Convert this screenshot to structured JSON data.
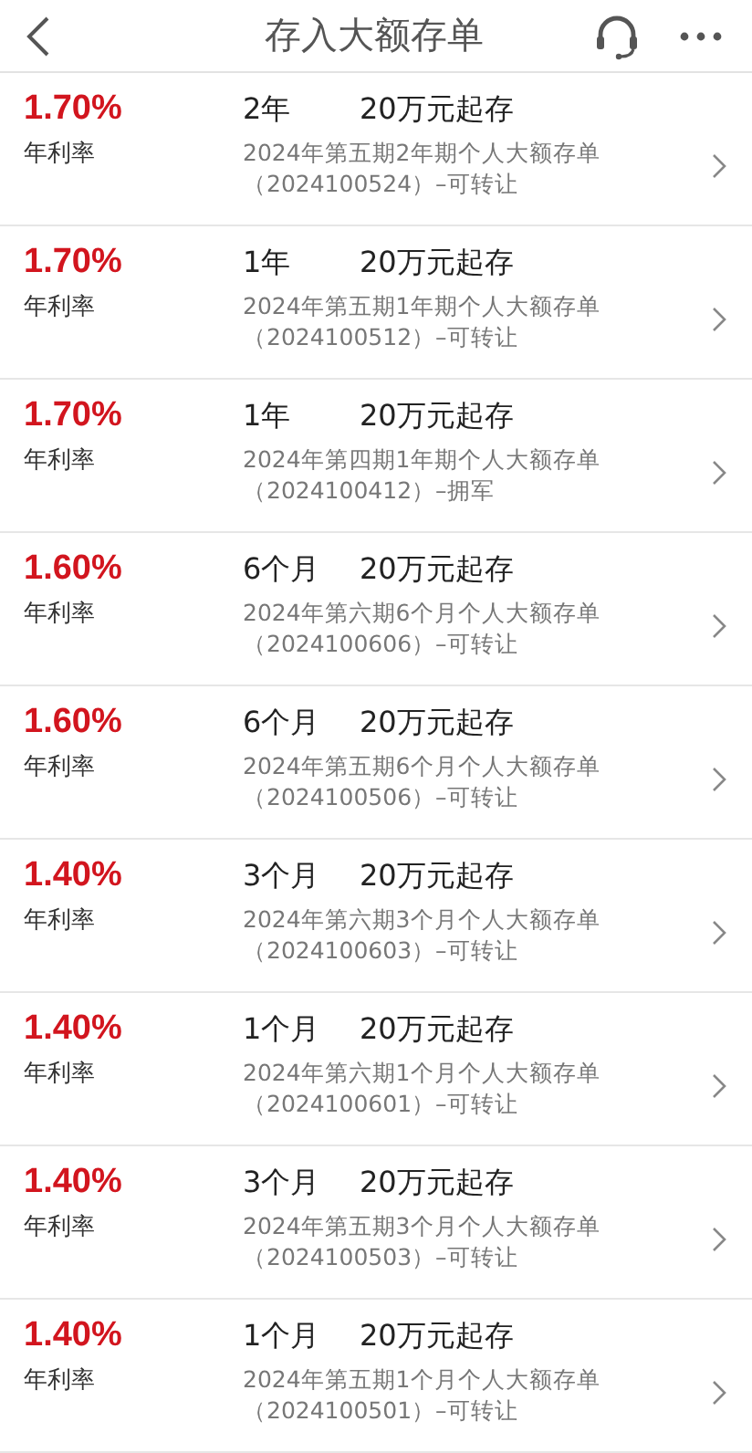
{
  "header": {
    "title": "存入大额存单"
  },
  "products": [
    {
      "rate": "1.70%",
      "rate_label": "年利率",
      "term": "2年",
      "minimum": "20万元起存",
      "name": "2024年第五期2年期个人大额存单",
      "code": "（2024100524）–可转让"
    },
    {
      "rate": "1.70%",
      "rate_label": "年利率",
      "term": "1年",
      "minimum": "20万元起存",
      "name": "2024年第五期1年期个人大额存单",
      "code": "（2024100512）–可转让"
    },
    {
      "rate": "1.70%",
      "rate_label": "年利率",
      "term": "1年",
      "minimum": "20万元起存",
      "name": "2024年第四期1年期个人大额存单",
      "code": "（2024100412）–拥军"
    },
    {
      "rate": "1.60%",
      "rate_label": "年利率",
      "term": "6个月",
      "minimum": "20万元起存",
      "name": "2024年第六期6个月个人大额存单",
      "code": "（2024100606）–可转让"
    },
    {
      "rate": "1.60%",
      "rate_label": "年利率",
      "term": "6个月",
      "minimum": "20万元起存",
      "name": "2024年第五期6个月个人大额存单",
      "code": "（2024100506）–可转让"
    },
    {
      "rate": "1.40%",
      "rate_label": "年利率",
      "term": "3个月",
      "minimum": "20万元起存",
      "name": "2024年第六期3个月个人大额存单",
      "code": "（2024100603）–可转让"
    },
    {
      "rate": "1.40%",
      "rate_label": "年利率",
      "term": "1个月",
      "minimum": "20万元起存",
      "name": "2024年第六期1个月个人大额存单",
      "code": "（2024100601）–可转让"
    },
    {
      "rate": "1.40%",
      "rate_label": "年利率",
      "term": "3个月",
      "minimum": "20万元起存",
      "name": "2024年第五期3个月个人大额存单",
      "code": "（2024100503）–可转让"
    },
    {
      "rate": "1.40%",
      "rate_label": "年利率",
      "term": "1个月",
      "minimum": "20万元起存",
      "name": "2024年第五期1个月个人大额存单",
      "code": "（2024100501）–可转让"
    }
  ]
}
